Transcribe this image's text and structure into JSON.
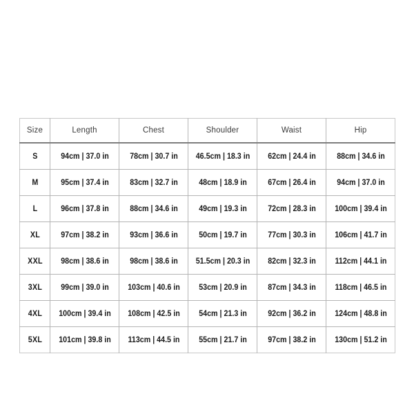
{
  "chart_data": {
    "type": "table",
    "title": "",
    "columns": [
      "Size",
      "Length",
      "Chest",
      "Shoulder",
      "Waist",
      "Hip"
    ],
    "rows": [
      {
        "size": "S",
        "length": "94cm | 37.0 in",
        "chest": "78cm | 30.7 in",
        "shoulder": "46.5cm | 18.3 in",
        "waist": "62cm | 24.4 in",
        "hip": "88cm | 34.6 in"
      },
      {
        "size": "M",
        "length": "95cm | 37.4 in",
        "chest": "83cm | 32.7 in",
        "shoulder": "48cm | 18.9 in",
        "waist": "67cm | 26.4 in",
        "hip": "94cm | 37.0 in"
      },
      {
        "size": "L",
        "length": "96cm | 37.8 in",
        "chest": "88cm | 34.6 in",
        "shoulder": "49cm | 19.3 in",
        "waist": "72cm | 28.3 in",
        "hip": "100cm | 39.4 in"
      },
      {
        "size": "XL",
        "length": "97cm | 38.2 in",
        "chest": "93cm | 36.6 in",
        "shoulder": "50cm | 19.7 in",
        "waist": "77cm | 30.3 in",
        "hip": "106cm | 41.7 in"
      },
      {
        "size": "XXL",
        "length": "98cm | 38.6 in",
        "chest": "98cm | 38.6 in",
        "shoulder": "51.5cm | 20.3 in",
        "waist": "82cm | 32.3 in",
        "hip": "112cm | 44.1 in"
      },
      {
        "size": "3XL",
        "length": "99cm | 39.0 in",
        "chest": "103cm | 40.6 in",
        "shoulder": "53cm | 20.9 in",
        "waist": "87cm | 34.3 in",
        "hip": "118cm | 46.5 in"
      },
      {
        "size": "4XL",
        "length": "100cm | 39.4 in",
        "chest": "108cm | 42.5 in",
        "shoulder": "54cm | 21.3 in",
        "waist": "92cm | 36.2 in",
        "hip": "124cm | 48.8 in"
      },
      {
        "size": "5XL",
        "length": "101cm | 39.8 in",
        "chest": "113cm | 44.5 in",
        "shoulder": "55cm | 21.7 in",
        "waist": "97cm | 38.2 in",
        "hip": "130cm | 51.2 in"
      }
    ],
    "units": {
      "metric": "cm",
      "imperial": "in"
    },
    "separator": "|"
  },
  "colors": {
    "page_background": "#ffffff",
    "table_background": "#ffffff",
    "header_text": "#3a3a3a",
    "body_text": "#1a1a1a",
    "inner_border": "#b4b4b4",
    "header_divider": "#7d7d7d",
    "outer_border": "#c8c8c8"
  }
}
